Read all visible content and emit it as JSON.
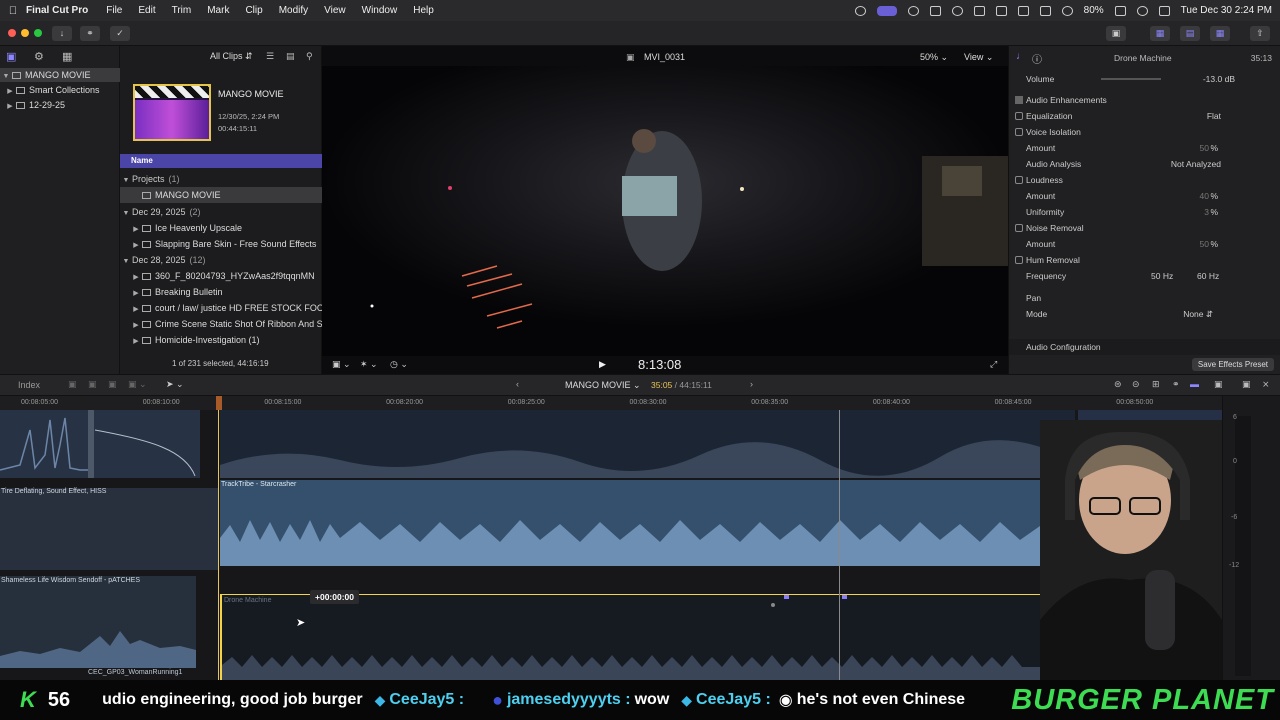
{
  "menubar": {
    "app_name": "Final Cut Pro",
    "items": [
      "File",
      "Edit",
      "Trim",
      "Mark",
      "Clip",
      "Modify",
      "View",
      "Window",
      "Help"
    ],
    "battery": "80%",
    "datetime": "Tue Dec 30  2:24 PM"
  },
  "library": {
    "items": [
      {
        "label": "MANGO MOVIE",
        "selected": true
      },
      {
        "label": "Smart Collections",
        "selected": false
      },
      {
        "label": "12-29-25",
        "selected": false
      }
    ]
  },
  "browser": {
    "filter": "All Clips",
    "project": {
      "title": "MANGO MOVIE",
      "date": "12/30/25, 2:24 PM",
      "duration": "00:44:15:11"
    },
    "column_header": "Name",
    "rows": [
      {
        "label": "Projects",
        "count": "(1)",
        "type": "group"
      },
      {
        "label": "MANGO MOVIE",
        "count": "",
        "type": "item-selected"
      },
      {
        "label": "Dec 29, 2025",
        "count": "(2)",
        "type": "group"
      },
      {
        "label": "Ice Heavenly Upscale",
        "count": "",
        "type": "item"
      },
      {
        "label": "Slapping Bare Skin - Free Sound Effects",
        "count": "",
        "type": "item"
      },
      {
        "label": "Dec 28, 2025",
        "count": "(12)",
        "type": "group"
      },
      {
        "label": "360_F_80204793_HYZwAas2f9tqqnMN",
        "count": "",
        "type": "item"
      },
      {
        "label": "Breaking Bulletin",
        "count": "",
        "type": "item"
      },
      {
        "label": "court / law/ justice HD FREE STOCK FOO",
        "count": "",
        "type": "item"
      },
      {
        "label": "Crime Scene Static Shot Of Ribbon And S",
        "count": "",
        "type": "item"
      },
      {
        "label": "Homicide-Investigation (1)",
        "count": "",
        "type": "item"
      }
    ],
    "status": "1 of 231 selected, 44:16:19"
  },
  "viewer": {
    "clip_name": "MVI_0031",
    "zoom": "50%",
    "view_label": "View",
    "timecode": "8:13:08"
  },
  "inspector": {
    "clip_title": "Drone Machine",
    "duration": "35:13",
    "volume_label": "Volume",
    "volume_value": "-13.0",
    "volume_unit": "dB",
    "section": "Audio Enhancements",
    "rows": [
      {
        "label": "Equalization",
        "value": "Flat",
        "checkbox": true
      },
      {
        "label": "Voice Isolation",
        "value": "",
        "checkbox": true
      },
      {
        "label": "Amount",
        "value": "50",
        "unit": "%",
        "checkbox": false
      },
      {
        "label": "Audio Analysis",
        "value": "Not Analyzed",
        "checkbox": false
      },
      {
        "label": "Loudness",
        "value": "",
        "checkbox": true
      },
      {
        "label": "Amount",
        "value": "40",
        "unit": "%",
        "checkbox": false
      },
      {
        "label": "Uniformity",
        "value": "3",
        "unit": "%",
        "checkbox": false
      },
      {
        "label": "Noise Removal",
        "value": "",
        "checkbox": true
      },
      {
        "label": "Amount",
        "value": "50",
        "unit": "%",
        "checkbox": false
      },
      {
        "label": "Hum Removal",
        "value": "",
        "checkbox": true
      },
      {
        "label": "Frequency",
        "value": "50 Hz",
        "value2": "60 Hz",
        "checkbox": false
      }
    ],
    "pan_section": "Pan",
    "mode_label": "Mode",
    "mode_value": "None",
    "audio_config": "Audio Configuration",
    "save_preset": "Save Effects Preset"
  },
  "timeline": {
    "index_label": "Index",
    "project_name": "MANGO MOVIE",
    "position": "35:05",
    "total": "44:15:11",
    "ruler": [
      "00:08:05:00",
      "00:08:10:00",
      "00:08:15:00",
      "00:08:20:00",
      "00:08:25:00",
      "00:08:30:00",
      "00:08:35:00",
      "00:08:40:00",
      "00:08:45:00",
      "00:08:50:00"
    ],
    "clips": {
      "tire": "Tire Deflating, Sound Effect, HISS",
      "tracktribe": "TrackTribe - Starcrasher",
      "shameless": "Shameless Life Wisdom Sendoff - pATCHES",
      "drone": "Drone Machine",
      "cec": "CEC_GP03_WomanRunning1"
    },
    "offset_tooltip": "+00:00:00",
    "meter_labels": [
      "6",
      "0",
      "-6",
      "-12"
    ]
  },
  "ticker": {
    "letter": "K",
    "count": "56",
    "messages": [
      {
        "user": "",
        "text": "udio engineering, good job burger"
      },
      {
        "user": "CeeJay5 :",
        "text": ""
      },
      {
        "user": "jamesedyyyyts :",
        "text": "wow"
      },
      {
        "user": "CeeJay5 :",
        "text": "he's not even Chinese"
      }
    ],
    "brand": "BURGER PLANET"
  },
  "colors": {
    "accent": "#4b45a8",
    "playhead": "#e8c55a",
    "ticker_green": "#3ddc52",
    "selection_yellow": "#f2d34b"
  }
}
